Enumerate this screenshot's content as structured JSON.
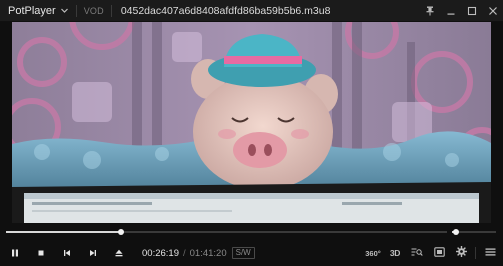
{
  "titlebar": {
    "app_name": "PotPlayer",
    "mode_label": "VOD",
    "file_title": "0452dac407a6d8408afdfd86ba59b5b6.m3u8"
  },
  "playback": {
    "current_time": "00:26:19",
    "separator": "/",
    "duration": "01:41:20",
    "sw_badge": "S/W",
    "progress_fraction": 0.26,
    "volume_fraction": 0.08
  },
  "controls": {
    "badge_360": "360°",
    "badge_3d": "3D"
  },
  "icons": [
    "chevron-down-icon",
    "pin-icon",
    "minimize-icon",
    "maximize-icon",
    "close-icon",
    "pause-icon",
    "stop-icon",
    "previous-icon",
    "next-icon",
    "eject-icon",
    "vr-360-icon",
    "3d-icon",
    "playlist-search-icon",
    "subtitles-icon",
    "settings-icon",
    "menu-icon"
  ],
  "colors": {
    "background": "#0f0f0f",
    "titlebar": "#1b1b1b",
    "accent": "#d8d8d8"
  }
}
